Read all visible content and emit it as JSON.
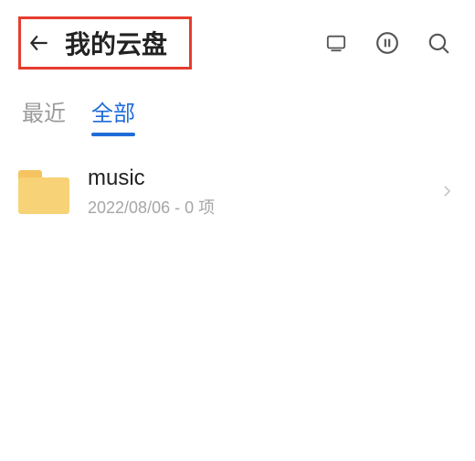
{
  "header": {
    "title": "我的云盘"
  },
  "tabs": {
    "recent": "最近",
    "all": "全部",
    "active": "all"
  },
  "files": [
    {
      "name": "music",
      "meta": "2022/08/06 - 0 项"
    }
  ]
}
